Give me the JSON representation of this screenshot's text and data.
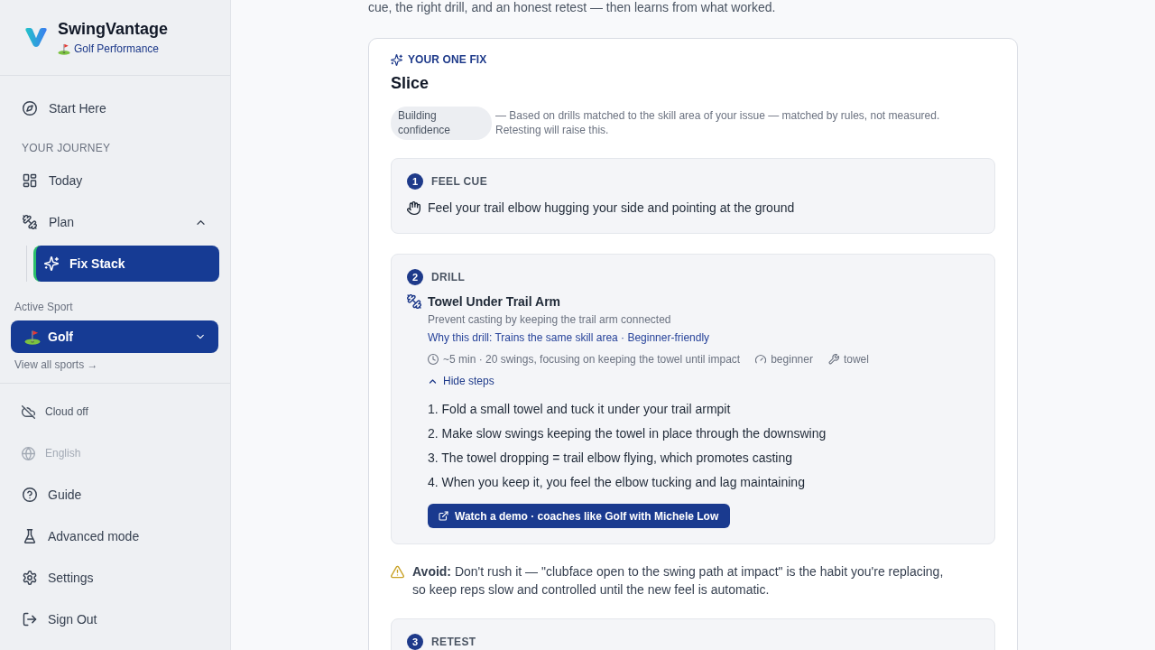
{
  "sidebar": {
    "brand": {
      "title": "SwingVantage",
      "subtitle": "Golf Performance"
    },
    "nav": [
      {
        "kind": "item",
        "label": "Start Here",
        "selected": false
      },
      {
        "kind": "section",
        "label": "YOUR JOURNEY"
      },
      {
        "kind": "item",
        "label": "Today",
        "selected": false
      },
      {
        "kind": "group",
        "label": "Plan",
        "selected": false,
        "expanded": true,
        "children": [
          {
            "label": "Fix Stack",
            "selected": true
          }
        ]
      }
    ],
    "active_sport": {
      "label": "Active Sport",
      "value": "Golf",
      "link": "View all sports →"
    },
    "status": [
      {
        "label": "Cloud off",
        "disabled": false
      },
      {
        "label": "English",
        "disabled": true
      }
    ],
    "footer_nav": [
      {
        "label": "Guide"
      },
      {
        "label": "Advanced mode"
      },
      {
        "label": "Settings"
      },
      {
        "label": "Sign Out"
      }
    ]
  },
  "main": {
    "intro": "cue, the right drill, and an honest retest — then learns from what worked.",
    "fix_card": {
      "eyebrow": "YOUR ONE FIX",
      "title": "Slice",
      "confidence": {
        "badge": "Building confidence",
        "note": "— Based on drills matched to the skill area of your issue — matched by rules, not measured. Retesting will raise this."
      },
      "sections": [
        {
          "kind": "cue",
          "number": "1",
          "label": "FEEL CUE",
          "text": "Feel your trail elbow hugging your side and pointing at the ground"
        },
        {
          "kind": "drill",
          "number": "2",
          "label": "DRILL",
          "title": "Towel Under Trail Arm",
          "description": "Prevent casting by keeping the trail arm connected",
          "why": "Why this drill: Trains the same skill area · Beginner-friendly",
          "meta": [
            {
              "kind": "time",
              "text": "~5 min · 20 swings, focusing on keeping the towel until impact"
            },
            {
              "kind": "level",
              "text": "beginner"
            },
            {
              "kind": "equipment",
              "text": "towel"
            }
          ],
          "toggle": {
            "label": "Hide steps",
            "expanded": true
          },
          "instructions": [
            "1. Fold a small towel and tuck it under your trail armpit",
            "2. Make slow swings keeping the towel in place through the downswing",
            "3. The towel dropping = trail elbow flying, which promotes casting",
            "4. When you keep it, you feel the elbow tucking and lag maintaining"
          ],
          "demo_button": "Watch a demo · coaches like Golf with Michele Low"
        },
        {
          "kind": "avoid",
          "text": "**Avoid:** Don't rush it — \"clubface open to the swing path at impact\" is the habit you're replacing, so keep reps slow and controlled until the new feel is automatic."
        },
        {
          "kind": "retest",
          "number": "3",
          "label": "RETEST"
        }
      ]
    }
  }
}
